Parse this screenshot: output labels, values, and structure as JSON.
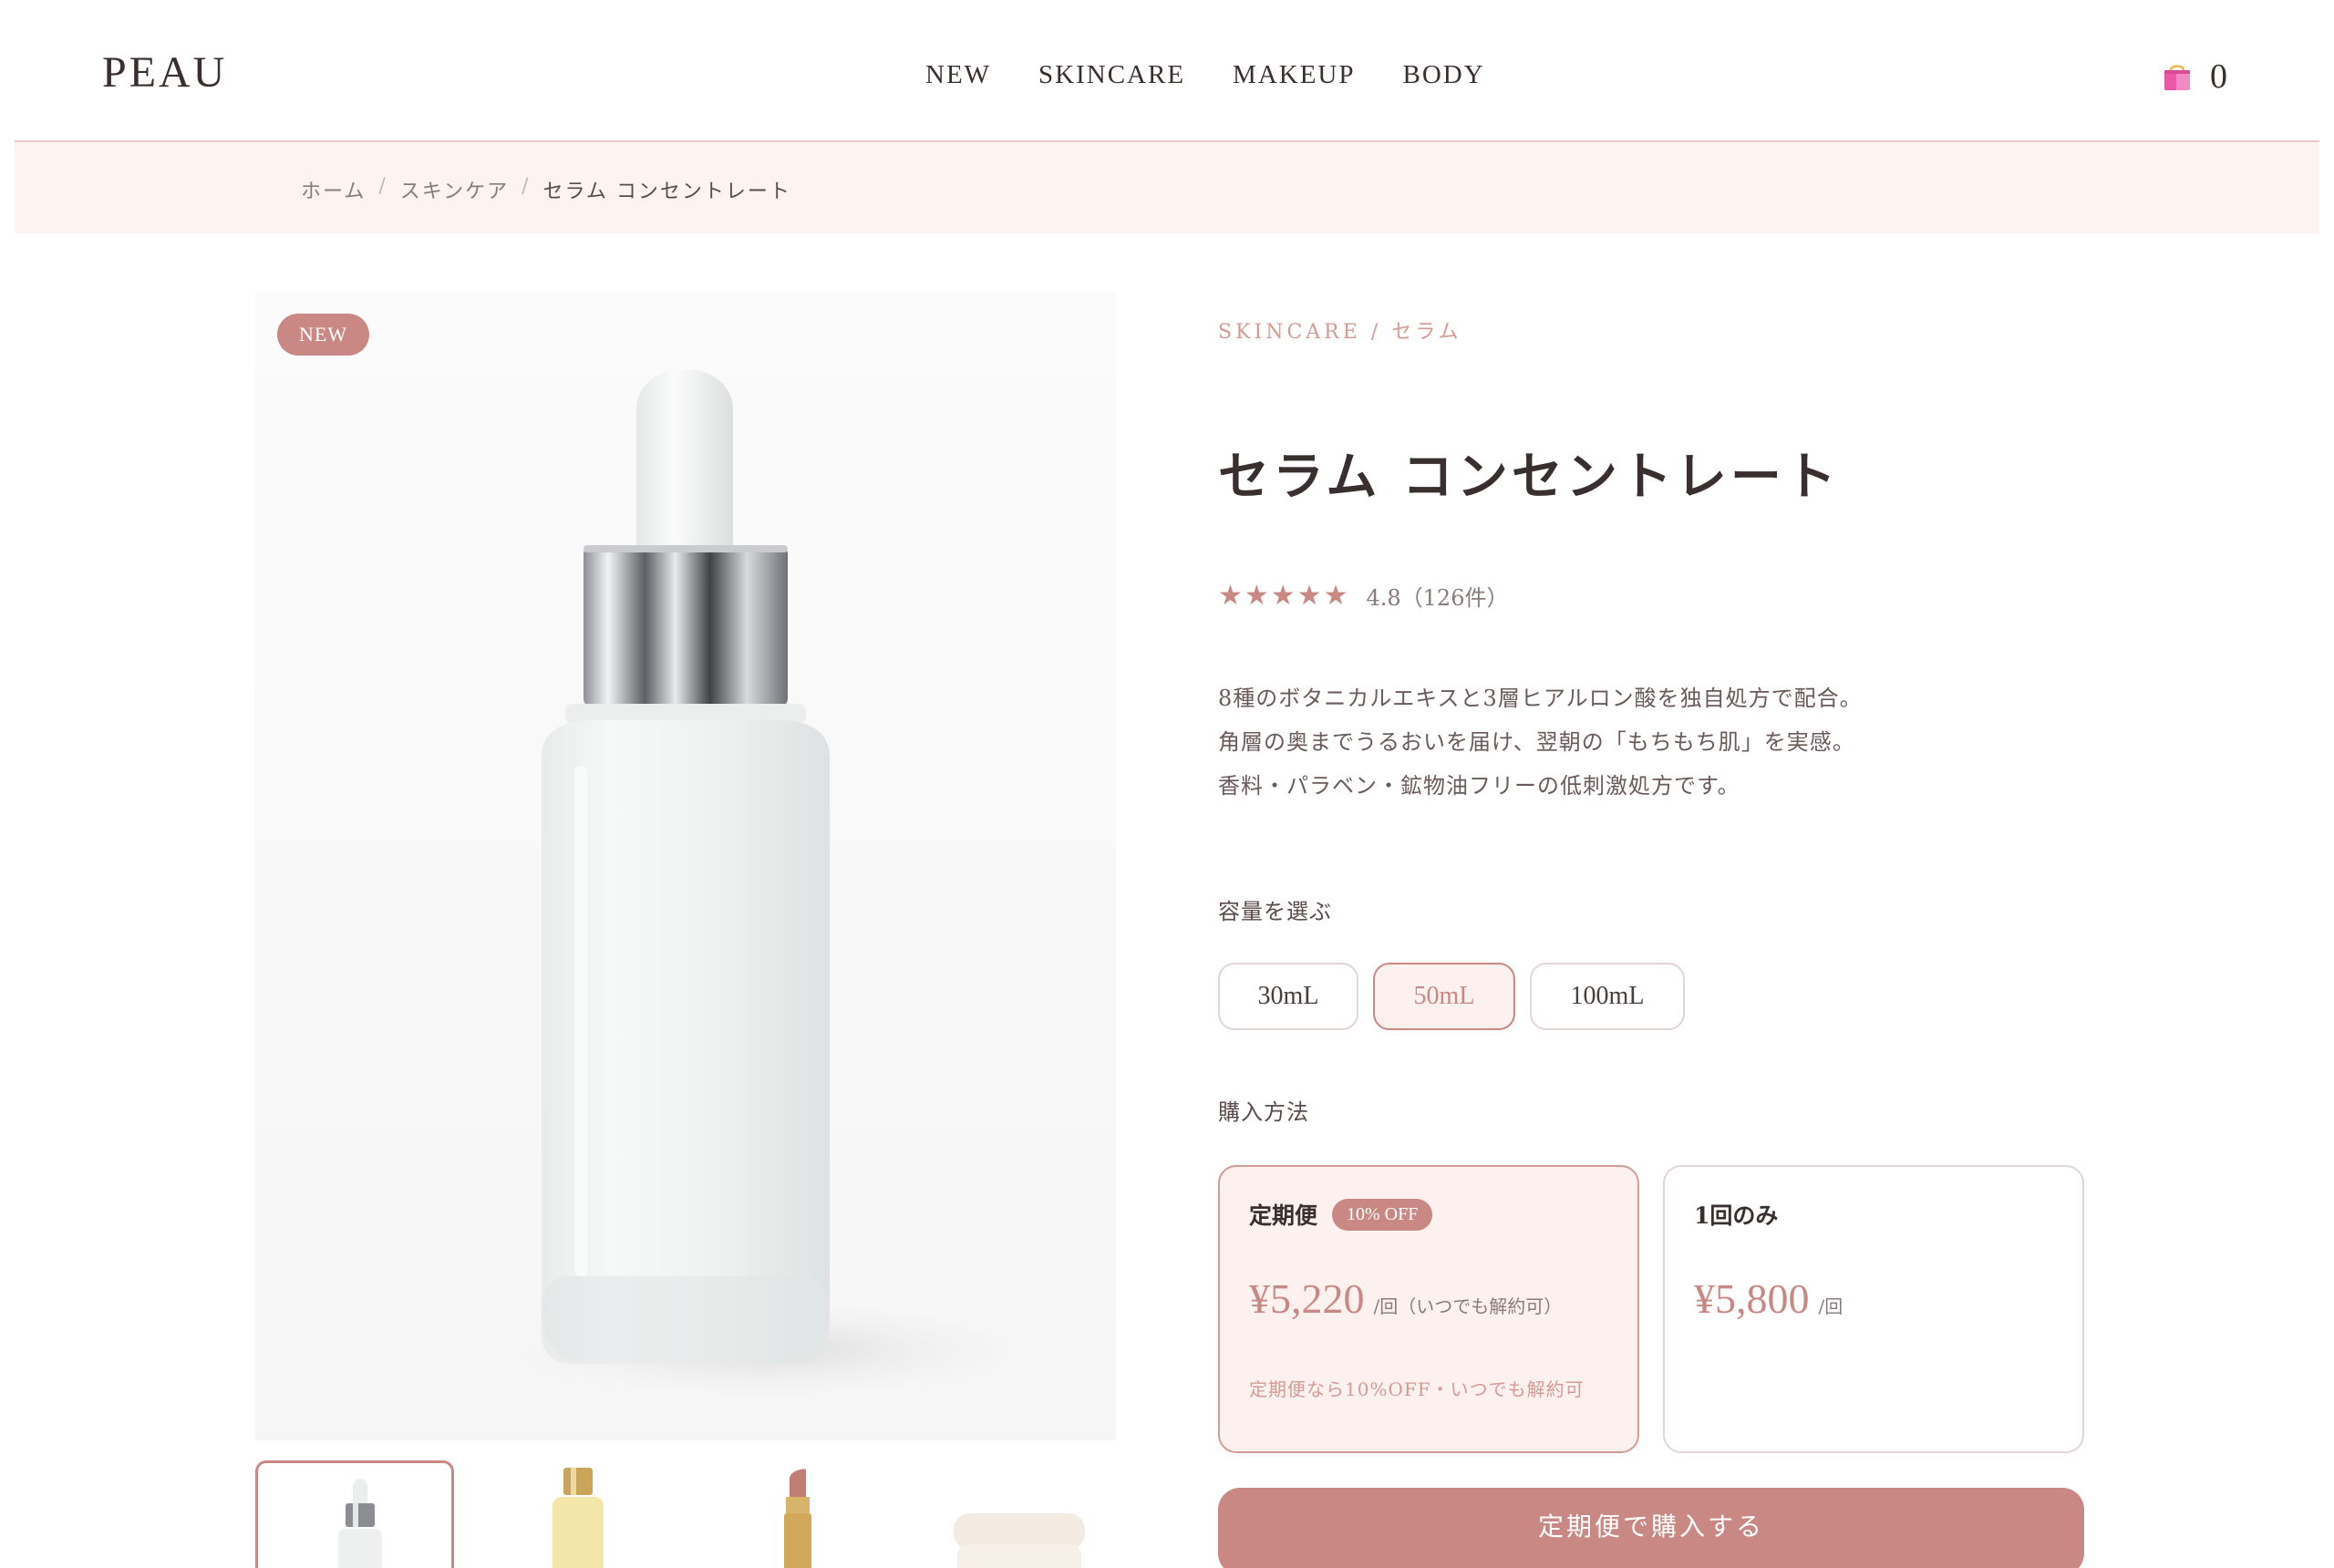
{
  "header": {
    "logo": "PEAU",
    "nav": [
      "NEW",
      "SKINCARE",
      "MAKEUP",
      "BODY"
    ],
    "cart_count": "0",
    "cart_icon": "shopping-bag-icon"
  },
  "breadcrumb": {
    "items": [
      "ホーム",
      "スキンケア",
      "セラム コンセントレート"
    ],
    "separator": "/"
  },
  "product": {
    "badge": "NEW",
    "category": "SKINCARE / セラム",
    "title": "セラム コンセントレート",
    "stars": "★★★★★",
    "rating": 4.8,
    "rating_text": "4.8（126件）",
    "description": [
      "8種のボタニカルエキスと3層ヒアルロン酸を独自処方で配合。",
      "角層の奥までうるおいを届け、翌朝の「もちもち肌」を実感。",
      "香料・パラベン・鉱物油フリーの低刺激処方です。"
    ]
  },
  "size": {
    "label": "容量を選ぶ",
    "options": [
      "30mL",
      "50mL",
      "100mL"
    ],
    "selected": "50mL"
  },
  "purchase": {
    "label": "購入方法",
    "plans": [
      {
        "name": "定期便",
        "badge": "10% OFF",
        "price": "¥5,220",
        "unit": "/回（いつでも解約可）",
        "note": "定期便なら10%OFF・いつでも解約可",
        "selected": true
      },
      {
        "name": "1回のみ",
        "price": "¥5,800",
        "unit": "/回",
        "selected": false
      }
    ],
    "cta": "定期便で購入する"
  },
  "thumbnails": [
    "serum-bottle",
    "oil-bottle",
    "lipstick",
    "cream-jar"
  ],
  "colors": {
    "accent": "#c98883",
    "accent_light": "#fdf1ef",
    "breadcrumb_bg": "#fdf3f1",
    "text": "#3a2f2f"
  }
}
